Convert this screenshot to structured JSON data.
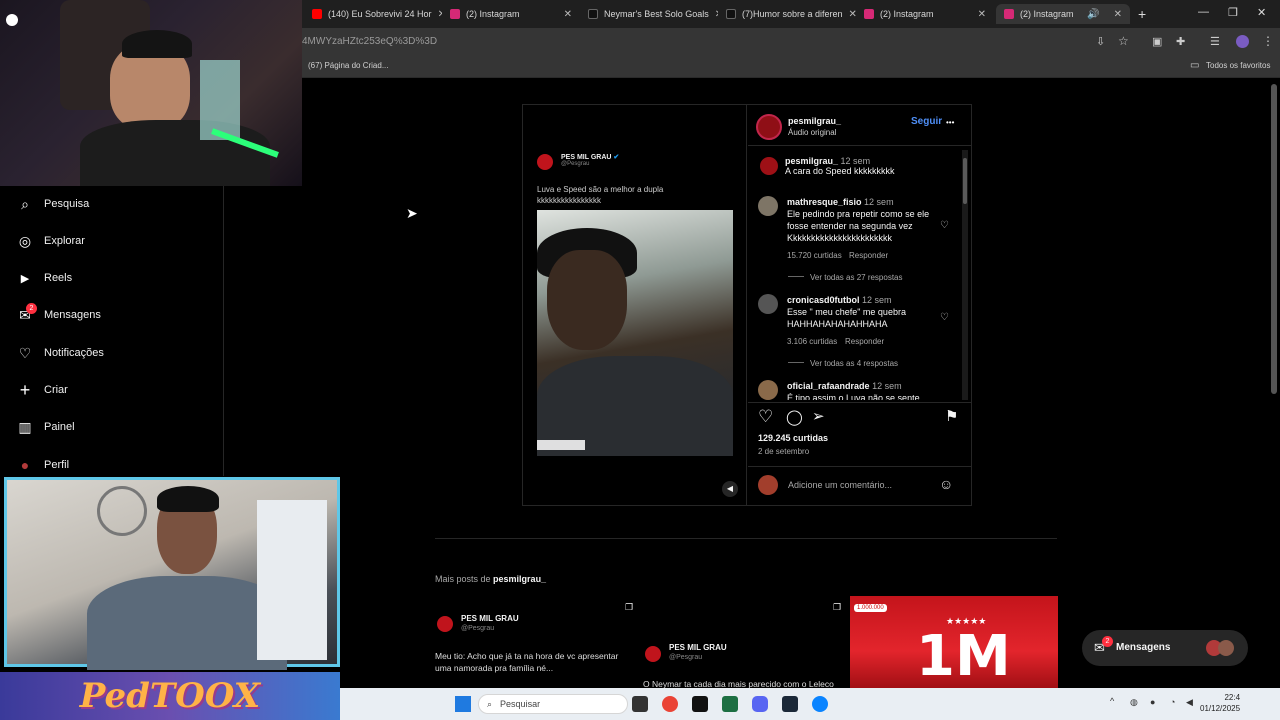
{
  "browser": {
    "tabs": [
      {
        "label": "(140) Eu Sobrevivi 24 Hor",
        "favicon_color": "#ff0000"
      },
      {
        "label": "(2) Instagram",
        "favicon_color": "#d62976"
      },
      {
        "label": "Neymar's Best Solo Goals",
        "favicon_color": "#111111"
      },
      {
        "label": "(7)Humor sobre a diferen",
        "favicon_color": "#111111"
      },
      {
        "label": "(2) Instagram",
        "favicon_color": "#d62976"
      },
      {
        "label": "(2) Instagram",
        "favicon_color": "#d62976"
      }
    ],
    "url": "4MWYzaHZtc253eQ%3D%3D",
    "bookmark_left": "(67) Página do Criad...",
    "bookmark_right": "Todos os favoritos",
    "new_tab": "+"
  },
  "nav": {
    "items": [
      {
        "label": "Pesquisa",
        "icon": "search-icon",
        "glyph": "⌕"
      },
      {
        "label": "Explorar",
        "icon": "compass-icon",
        "glyph": "◎"
      },
      {
        "label": "Reels",
        "icon": "reels-icon",
        "glyph": "▶"
      },
      {
        "label": "Mensagens",
        "icon": "messenger-icon",
        "glyph": "✉",
        "badge": "2"
      },
      {
        "label": "Notificações",
        "icon": "heart-icon",
        "glyph": "♡"
      },
      {
        "label": "Criar",
        "icon": "plus-icon",
        "glyph": "+"
      },
      {
        "label": "Painel",
        "icon": "dashboard-icon",
        "glyph": "▥"
      },
      {
        "label": "Perfil",
        "icon": "profile-avatar-icon",
        "glyph": "●"
      }
    ]
  },
  "post": {
    "username": "pesmilgrau_",
    "audio": "Áudio original",
    "follow": "Seguir",
    "more": "•••",
    "tweet_name": "PES MIL GRAU",
    "tweet_handle": "@Pesgrau",
    "tweet_text": "Luva e Speed são a melhor a dupla kkkkkkkkkkkkkkkk",
    "likes": "129.245 curtidas",
    "date": "2 de setembro",
    "comment_placeholder": "Adicione um comentário...",
    "comments": [
      {
        "user": "pesmilgrau_",
        "time": "12 sem",
        "text": "A cara do Speed kkkkkkkkk"
      },
      {
        "user": "mathresque_fisio",
        "time": "12 sem",
        "text": "Ele pedindo pra repetir como se ele fosse entender na segunda vez Kkkkkkkkkkkkkkkkkkkkkkk",
        "likes": "15.720 curtidas",
        "reply": "Responder",
        "view_replies": "Ver todas as 27 respostas"
      },
      {
        "user": "cronicasd0futbol",
        "time": "12 sem",
        "text": "Esse \" meu chefe\" me quebra HAHHAHAHAHAHHAHA",
        "likes": "3.106 curtidas",
        "reply": "Responder",
        "view_replies": "Ver todas as 4 respostas"
      },
      {
        "user": "oficial_rafaandrade",
        "time": "12 sem",
        "text": "É tipo assim o Luva não se sente"
      }
    ]
  },
  "more_posts": {
    "heading_prefix": "Mais posts de",
    "heading_user": "pesmilgrau_",
    "tile1_name": "PES MIL GRAU",
    "tile1_handle": "@Pesgrau",
    "tile1_text": "Meu tio: Acho que já ta na hora de vc apresentar uma namorada pra família né...",
    "tile2_name": "PES MIL GRAU",
    "tile2_handle": "@Pesgrau",
    "tile2_text": "O Neymar ta cada dia mais parecido com o Leleco",
    "tile3_big": "1M",
    "tile3_small": "1.000.000"
  },
  "messages_pill": {
    "label": "Mensagens",
    "badge": "2"
  },
  "overlay": {
    "brand": "PedTOOX"
  },
  "taskbar": {
    "search": "Pesquisar",
    "time": "22:4",
    "date": "01/12/2025"
  },
  "colors": {
    "accent": "#0095f6",
    "follow": "#4f8ff7",
    "badge": "#ff3040"
  }
}
